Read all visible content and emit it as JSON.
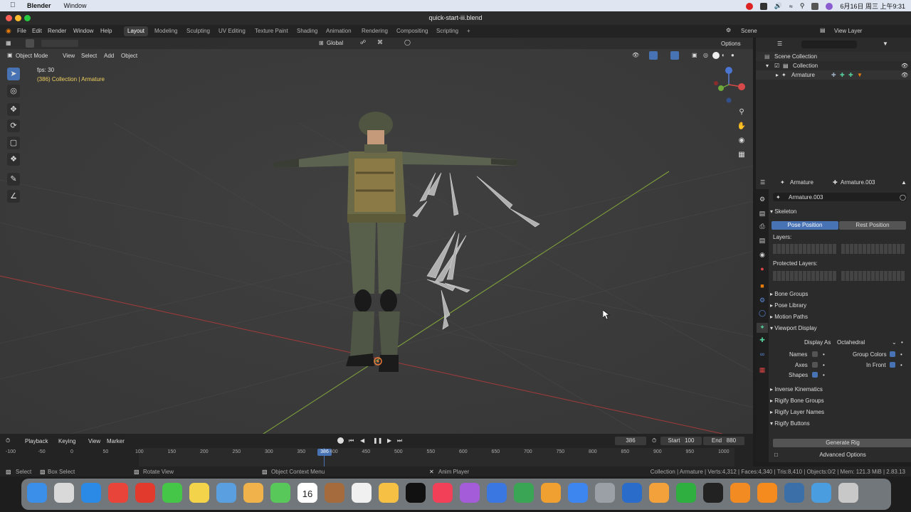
{
  "menubar": {
    "app": "Blender",
    "items": [
      "Window"
    ],
    "clock": "6月16日 周三 上午9:31"
  },
  "window": {
    "title": "quick-start-iii.blend"
  },
  "topbar": {
    "menus": [
      "File",
      "Edit",
      "Render",
      "Window",
      "Help"
    ],
    "workspaces": [
      "Layout",
      "Modeling",
      "Sculpting",
      "UV Editing",
      "Texture Paint",
      "Shading",
      "Animation",
      "Rendering",
      "Compositing",
      "Scripting"
    ],
    "active_workspace": "Layout",
    "add_tab": "+",
    "scene_label": "Scene",
    "view_layer_label": "View Layer"
  },
  "viewport": {
    "mode": "Object Mode",
    "menus": [
      "View",
      "Select",
      "Add",
      "Object"
    ],
    "orientation": "Global",
    "options": "Options",
    "fps_text": "fps: 30",
    "info_text": "(386) Collection | Armature"
  },
  "outliner": {
    "items": [
      {
        "label": "Scene Collection"
      },
      {
        "label": "Collection"
      },
      {
        "label": "Armature"
      }
    ]
  },
  "properties": {
    "context": "Armature",
    "data_name": "Armature.003",
    "field_value": "Armature.003",
    "skeleton_header": "Skeleton",
    "pose_position": "Pose Position",
    "rest_position": "Rest Position",
    "layers_label": "Layers:",
    "protected_layers_label": "Protected Layers:",
    "panels": [
      "Bone Groups",
      "Pose Library",
      "Motion Paths"
    ],
    "viewport_display_header": "Viewport Display",
    "display_as_label": "Display As",
    "display_as_value": "Octahedral",
    "names_label": "Names",
    "group_colors_label": "Group Colors",
    "axes_label": "Axes",
    "in_front_label": "In Front",
    "shapes_label": "Shapes",
    "lower_panels": [
      "Inverse Kinematics",
      "Rigify Bone Groups",
      "Rigify Layer Names",
      "Rigify Buttons"
    ],
    "generate_rig": "Generate Rig",
    "advanced_options": "Advanced Options"
  },
  "timeline": {
    "menus": [
      "Playback",
      "Keying",
      "View",
      "Marker"
    ],
    "current_frame": "386",
    "start_label": "Start",
    "start_value": "100",
    "end_label": "End",
    "end_value": "880",
    "ticks": [
      "-100",
      "-50",
      "0",
      "50",
      "100",
      "150",
      "200",
      "250",
      "300",
      "350",
      "400",
      "450",
      "500",
      "550",
      "600",
      "650",
      "700",
      "750",
      "800",
      "850",
      "900",
      "950",
      "1000"
    ],
    "playhead_label": "386"
  },
  "statusbar": {
    "select": "Select",
    "box_select": "Box Select",
    "rotate_view": "Rotate View",
    "context_menu": "Object Context Menu",
    "anim_player": "Anim Player",
    "stats": "Collection | Armature | Verts:4,312 | Faces:4,340 | Tris:8,410 | Objects:0/2 | Mem: 121.3 MiB | 2.83.13"
  },
  "dock": {
    "calendar_day": "16",
    "colors": [
      "#3b8fe8",
      "#d9d9d9",
      "#2a8ae6",
      "#e8443a",
      "#e23b2e",
      "#45c648",
      "#f3d34a",
      "#5aa0e0",
      "#f0b24a",
      "#58c85a",
      "#e94040",
      "#a56b3c",
      "#f0f0f0",
      "#f5c043",
      "#111111",
      "#f24058",
      "#a45cd8",
      "#3a77e0",
      "#3aa655",
      "#f0a030",
      "#3d86f0",
      "#9aa0a6",
      "#2a6cc9",
      "#f3a13a",
      "#2eaf3f",
      "#222222",
      "#f28b22",
      "#f58a1e",
      "#3b6fa8",
      "#4a9ee0",
      "#c8c8c8"
    ]
  }
}
